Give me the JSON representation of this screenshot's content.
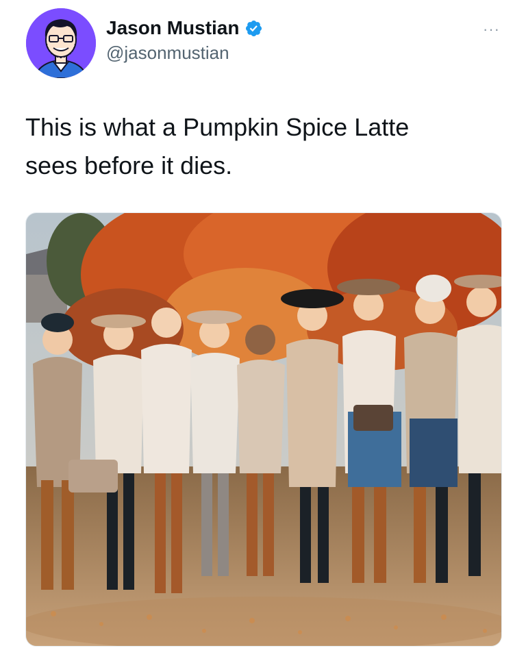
{
  "tweet": {
    "author": {
      "display_name": "Jason Mustian",
      "handle": "@jasonmustian",
      "verified": true,
      "avatar_bg": "#7b4dff"
    },
    "text": "This is what a Pumpkin Spice Latte\nsees before it dies.",
    "more_menu": "···",
    "media": {
      "icon": "photo",
      "description": "Group photo of nine women in autumn outfits standing in front of orange fall trees on a leaf-covered lawn"
    }
  },
  "colors": {
    "verified_blue": "#1d9bf0",
    "text_primary": "#0f1419",
    "text_secondary": "#536471"
  }
}
